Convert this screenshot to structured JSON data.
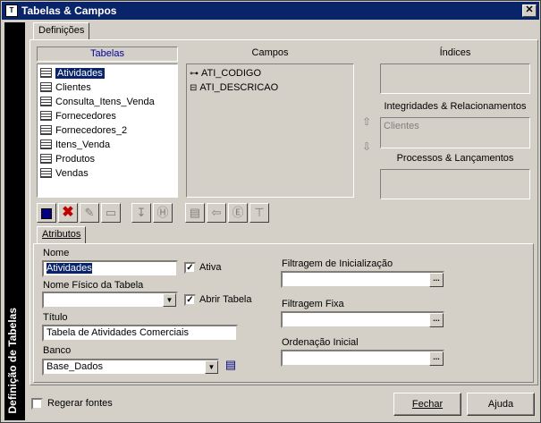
{
  "window": {
    "title": "Tabelas & Campos",
    "close_label": "✕",
    "sidebar_title": "Definição de Tabelas"
  },
  "tabs": {
    "main": "Definições",
    "attr": "Atributos"
  },
  "tabelas": {
    "header": "Tabelas",
    "items": [
      "Atividades",
      "Clientes",
      "Consulta_Itens_Venda",
      "Fornecedores",
      "Fornecedores_2",
      "Itens_Venda",
      "Produtos",
      "Vendas"
    ],
    "selected": "Atividades"
  },
  "campos": {
    "header": "Campos",
    "items": [
      "ATI_CODIGO",
      "ATI_DESCRICAO"
    ]
  },
  "indices": {
    "header": "Índices"
  },
  "integridades": {
    "header": "Integridades & Relacionamentos",
    "items": [
      "Clientes"
    ]
  },
  "processos": {
    "header": "Processos & Lançamentos"
  },
  "atributos": {
    "nome_label": "Nome",
    "nome_value": "Atividades",
    "ativa_label": "Ativa",
    "ativa_checked": "✓",
    "nome_fisico_label": "Nome Físico da Tabela",
    "nome_fisico_value": "",
    "abrir_label": "Abrir Tabela",
    "abrir_checked": "✓",
    "titulo_label": "Título",
    "titulo_value": "Tabela de Atividades Comerciais",
    "banco_label": "Banco",
    "banco_value": "Base_Dados",
    "filtragem_inicial_label": "Filtragem de Inicialização",
    "filtragem_inicial_value": "",
    "filtragem_fixa_label": "Filtragem Fixa",
    "filtragem_fixa_value": "",
    "ordenacao_label": "Ordenação Inicial",
    "ordenacao_value": ""
  },
  "footer": {
    "regerar_label": "Regerar fontes",
    "fechar_label": "Fechar",
    "ajuda_label": "Ajuda"
  },
  "icons": {
    "arrow_down": "▼",
    "dots": "...",
    "field": "⊶",
    "up": "⇧",
    "down": "⇩"
  }
}
